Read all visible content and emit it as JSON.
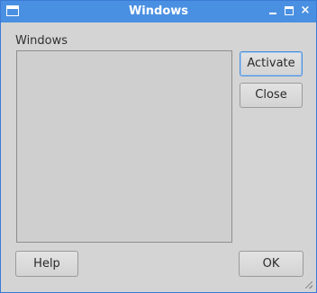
{
  "window": {
    "title": "Windows",
    "icons": {
      "app": "window-icon",
      "minimize": "minimize-icon",
      "maximize": "maximize-icon",
      "close": "close-icon",
      "close_glyph": "×"
    }
  },
  "dialog": {
    "list_label": "Windows",
    "list_items": [],
    "buttons": {
      "activate": "Activate",
      "close": "Close",
      "help": "Help",
      "ok": "OK"
    }
  },
  "colors": {
    "titlebar": "#4a90e2",
    "background": "#d4d4d4",
    "focus_border": "#4a90d9"
  }
}
